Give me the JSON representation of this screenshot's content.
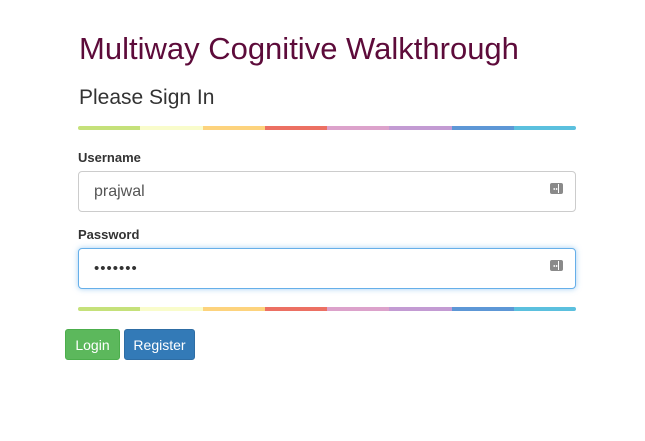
{
  "app": {
    "title": "Multiway Cognitive Walkthrough"
  },
  "login": {
    "heading": "Please Sign In",
    "username_label": "Username",
    "username_value": "prajwal",
    "password_label": "Password",
    "password_value": "abcdefg",
    "focused_field": "password"
  },
  "buttons": {
    "login_label": "Login",
    "register_label": "Register"
  },
  "icons": {
    "username_field_icon": "autofill-card-icon",
    "password_field_icon": "autofill-card-icon"
  },
  "colors": {
    "title": "#5d0b3a",
    "login_button": "#5cb85c",
    "register_button": "#337ab7",
    "focus_ring": "#66afe9",
    "divider_segments": [
      "#c5e17a",
      "#f9fccb",
      "#fdd37d",
      "#ec7063",
      "#dca2cb",
      "#c39bd3",
      "#5d97d6",
      "#5bc0de"
    ]
  }
}
